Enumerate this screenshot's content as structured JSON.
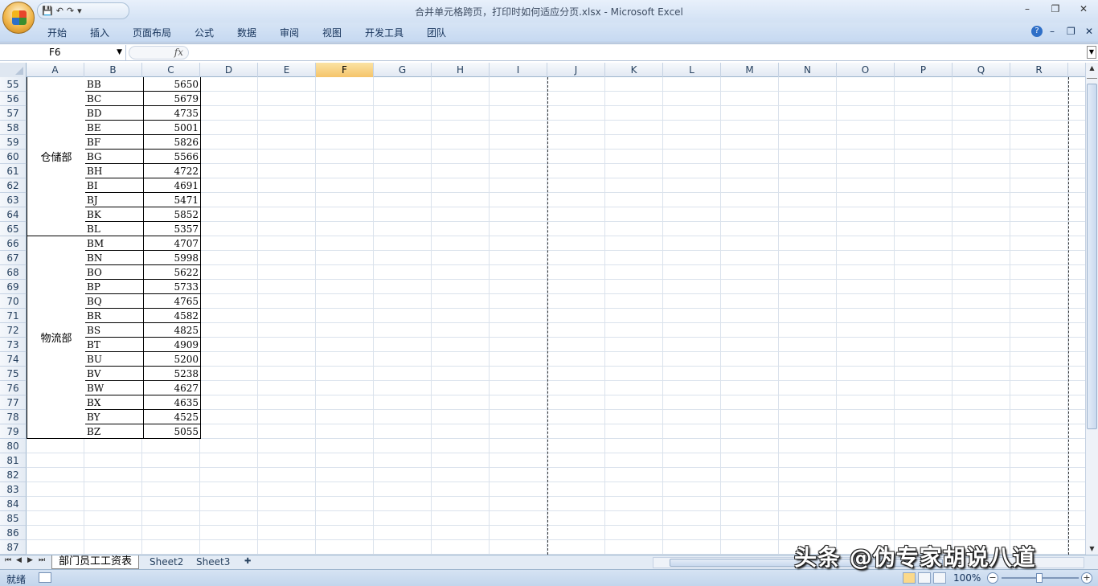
{
  "window": {
    "title": "合并单元格跨页，打印时如何适应分页.xlsx - Microsoft Excel",
    "controls": [
      "–",
      "❐",
      "✕"
    ],
    "doc_controls": [
      "?",
      "–",
      "❐",
      "✕"
    ]
  },
  "quick_access": {
    "save": "💾",
    "undo": "↶",
    "redo": "↷",
    "customize": "▾"
  },
  "ribbon": {
    "tabs": [
      "开始",
      "插入",
      "页面布局",
      "公式",
      "数据",
      "审阅",
      "视图",
      "开发工具",
      "团队"
    ]
  },
  "formula_bar": {
    "name_box": "F6",
    "fx_label": "fx",
    "formula": ""
  },
  "columns": [
    "A",
    "B",
    "C",
    "D",
    "E",
    "F",
    "G",
    "H",
    "I",
    "J",
    "K",
    "L",
    "M",
    "N",
    "O",
    "P",
    "Q",
    "R"
  ],
  "selected_column": "F",
  "row_numbers": [
    "55",
    "56",
    "57",
    "58",
    "59",
    "60",
    "61",
    "62",
    "63",
    "64",
    "65",
    "66",
    "67",
    "68",
    "69",
    "70",
    "71",
    "72",
    "73",
    "74",
    "75",
    "76",
    "77",
    "78",
    "79",
    "80",
    "81",
    "82",
    "83",
    "84",
    "85",
    "86",
    "87"
  ],
  "merged_cells": [
    {
      "label": "仓储部",
      "first_row": 55,
      "last_row": 65
    },
    {
      "label": "物流部",
      "first_row": 66,
      "last_row": 79
    }
  ],
  "rows": [
    {
      "row": 55,
      "b": "BB",
      "c": "5650"
    },
    {
      "row": 56,
      "b": "BC",
      "c": "5679"
    },
    {
      "row": 57,
      "b": "BD",
      "c": "4735"
    },
    {
      "row": 58,
      "b": "BE",
      "c": "5001"
    },
    {
      "row": 59,
      "b": "BF",
      "c": "5826"
    },
    {
      "row": 60,
      "b": "BG",
      "c": "5566"
    },
    {
      "row": 61,
      "b": "BH",
      "c": "4722"
    },
    {
      "row": 62,
      "b": "BI",
      "c": "4691"
    },
    {
      "row": 63,
      "b": "BJ",
      "c": "5471"
    },
    {
      "row": 64,
      "b": "BK",
      "c": "5852"
    },
    {
      "row": 65,
      "b": "BL",
      "c": "5357"
    },
    {
      "row": 66,
      "b": "BM",
      "c": "4707"
    },
    {
      "row": 67,
      "b": "BN",
      "c": "5998"
    },
    {
      "row": 68,
      "b": "BO",
      "c": "5622"
    },
    {
      "row": 69,
      "b": "BP",
      "c": "5733"
    },
    {
      "row": 70,
      "b": "BQ",
      "c": "4765"
    },
    {
      "row": 71,
      "b": "BR",
      "c": "4582"
    },
    {
      "row": 72,
      "b": "BS",
      "c": "4825"
    },
    {
      "row": 73,
      "b": "BT",
      "c": "4909"
    },
    {
      "row": 74,
      "b": "BU",
      "c": "5200"
    },
    {
      "row": 75,
      "b": "BV",
      "c": "5238"
    },
    {
      "row": 76,
      "b": "BW",
      "c": "4627"
    },
    {
      "row": 77,
      "b": "BX",
      "c": "4635"
    },
    {
      "row": 78,
      "b": "BY",
      "c": "4525"
    },
    {
      "row": 79,
      "b": "BZ",
      "c": "5055"
    }
  ],
  "sheets": {
    "nav": [
      "⏮",
      "◀",
      "▶",
      "⏭"
    ],
    "tabs": [
      "部门员工工资表",
      "Sheet2",
      "Sheet3"
    ],
    "active": "部门员工工资表"
  },
  "status": {
    "ready": "就绪",
    "zoom": "100%",
    "zoom_minus": "−",
    "zoom_plus": "+"
  },
  "watermark": "头条 @伪专家胡说八道"
}
